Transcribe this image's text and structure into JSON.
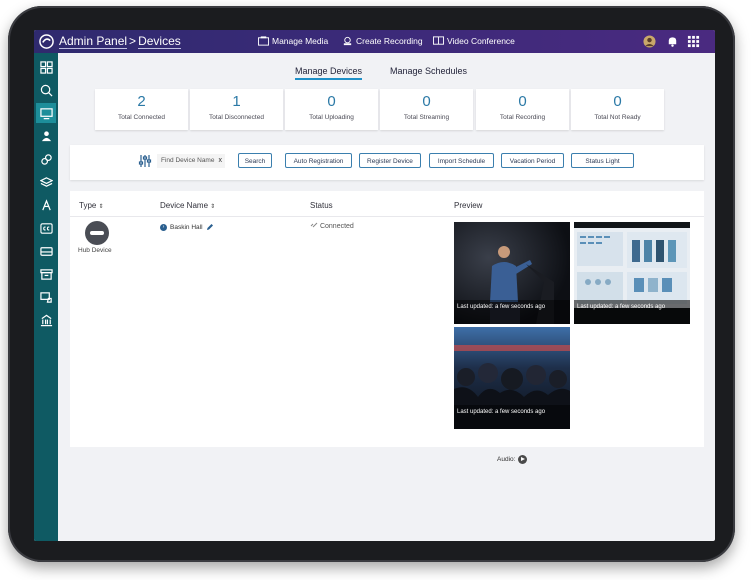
{
  "header": {
    "app_title": "Admin Panel",
    "separator": ">",
    "section": "Devices",
    "nav": [
      {
        "label": "Manage Media",
        "icon": "media-icon"
      },
      {
        "label": "Create Recording",
        "icon": "recording-icon"
      },
      {
        "label": "Video Conference",
        "icon": "conference-icon"
      }
    ],
    "right_icons": [
      "user-icon",
      "bell-icon",
      "apps-grid-icon"
    ]
  },
  "sidebar": {
    "items": [
      "dashboard-icon",
      "analytics-icon",
      "devices-icon",
      "users-icon",
      "integrations-icon",
      "layers-icon",
      "access-icon",
      "captions-icon",
      "storage-icon",
      "archive-icon",
      "security-icon",
      "building-icon"
    ],
    "active_index": 2
  },
  "tabs": [
    {
      "label": "Manage Devices",
      "active": true
    },
    {
      "label": "Manage Schedules",
      "active": false
    }
  ],
  "stats": [
    {
      "value": "2",
      "label": "Total Connected"
    },
    {
      "value": "1",
      "label": "Total Disconnected"
    },
    {
      "value": "0",
      "label": "Total Uploading"
    },
    {
      "value": "0",
      "label": "Total Streaming"
    },
    {
      "value": "0",
      "label": "Total Recording"
    },
    {
      "value": "0",
      "label": "Total Not Ready"
    }
  ],
  "toolbar": {
    "search_placeholder": "Find Device Name",
    "clear_label": "x",
    "buttons": [
      "Search",
      "Auto Registration",
      "Register Device",
      "Import Schedule",
      "Vacation Period",
      "Status Light"
    ]
  },
  "table": {
    "columns": [
      "Type",
      "Device Name",
      "Status",
      "Preview"
    ],
    "sort_glyph": "⇕",
    "row": {
      "type": "Hub Device",
      "name": "Baskin Hall",
      "status": "Connected",
      "previews": [
        "Last updated: a few seconds ago",
        "Last updated: a few seconds ago",
        "Last updated: a few seconds ago"
      ],
      "audio_label": "Audio:"
    }
  },
  "colors": {
    "topbar": "#2f2a6e",
    "sidebar": "#0f5a63",
    "accent": "#1e90c8",
    "stat_number": "#2b79a6"
  }
}
